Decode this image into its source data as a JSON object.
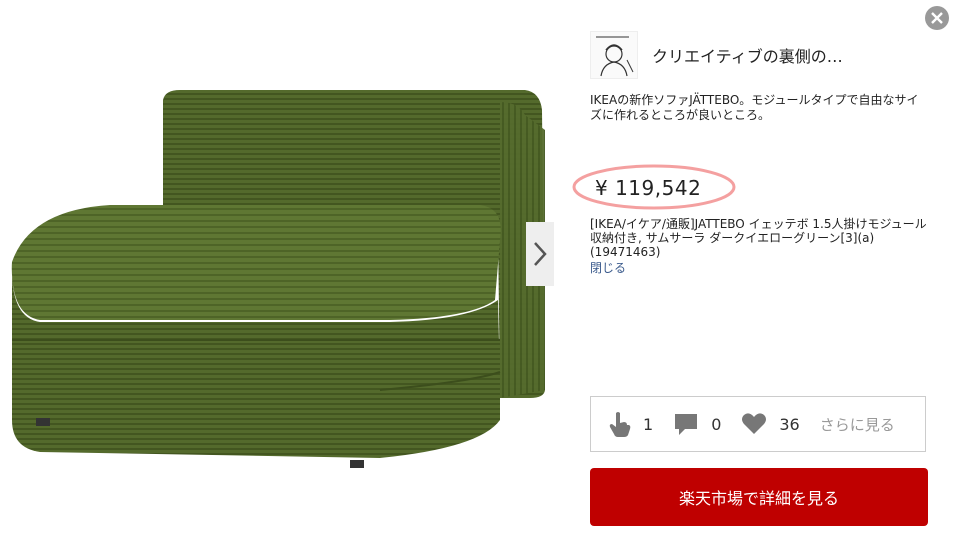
{
  "product": {
    "image_alt": "Dark yellow-green corduroy sofa module",
    "author_name": "クリエイティブの裏側の…",
    "description": "IKEAの新作ソファJÄTTEBO。モジュールタイプで自由なサイズに作れるところが良いところ。",
    "price": "¥ 119,542",
    "title": "[IKEA/イケア/通販]JATTEBO イェッテボ 1.5人掛けモジュール 収納付き, サムサーラ ダークイエローグリーン[3](a)(19471463)",
    "close_link": "閉じる"
  },
  "social": {
    "likes": "1",
    "comments": "0",
    "favorites": "36",
    "see_more": "さらに見る"
  },
  "cta": {
    "label": "楽天市場で詳細を見る"
  },
  "colors": {
    "sofa": "#4f6128",
    "cta": "#bf0000",
    "price_highlight": "#f4a0a0"
  }
}
